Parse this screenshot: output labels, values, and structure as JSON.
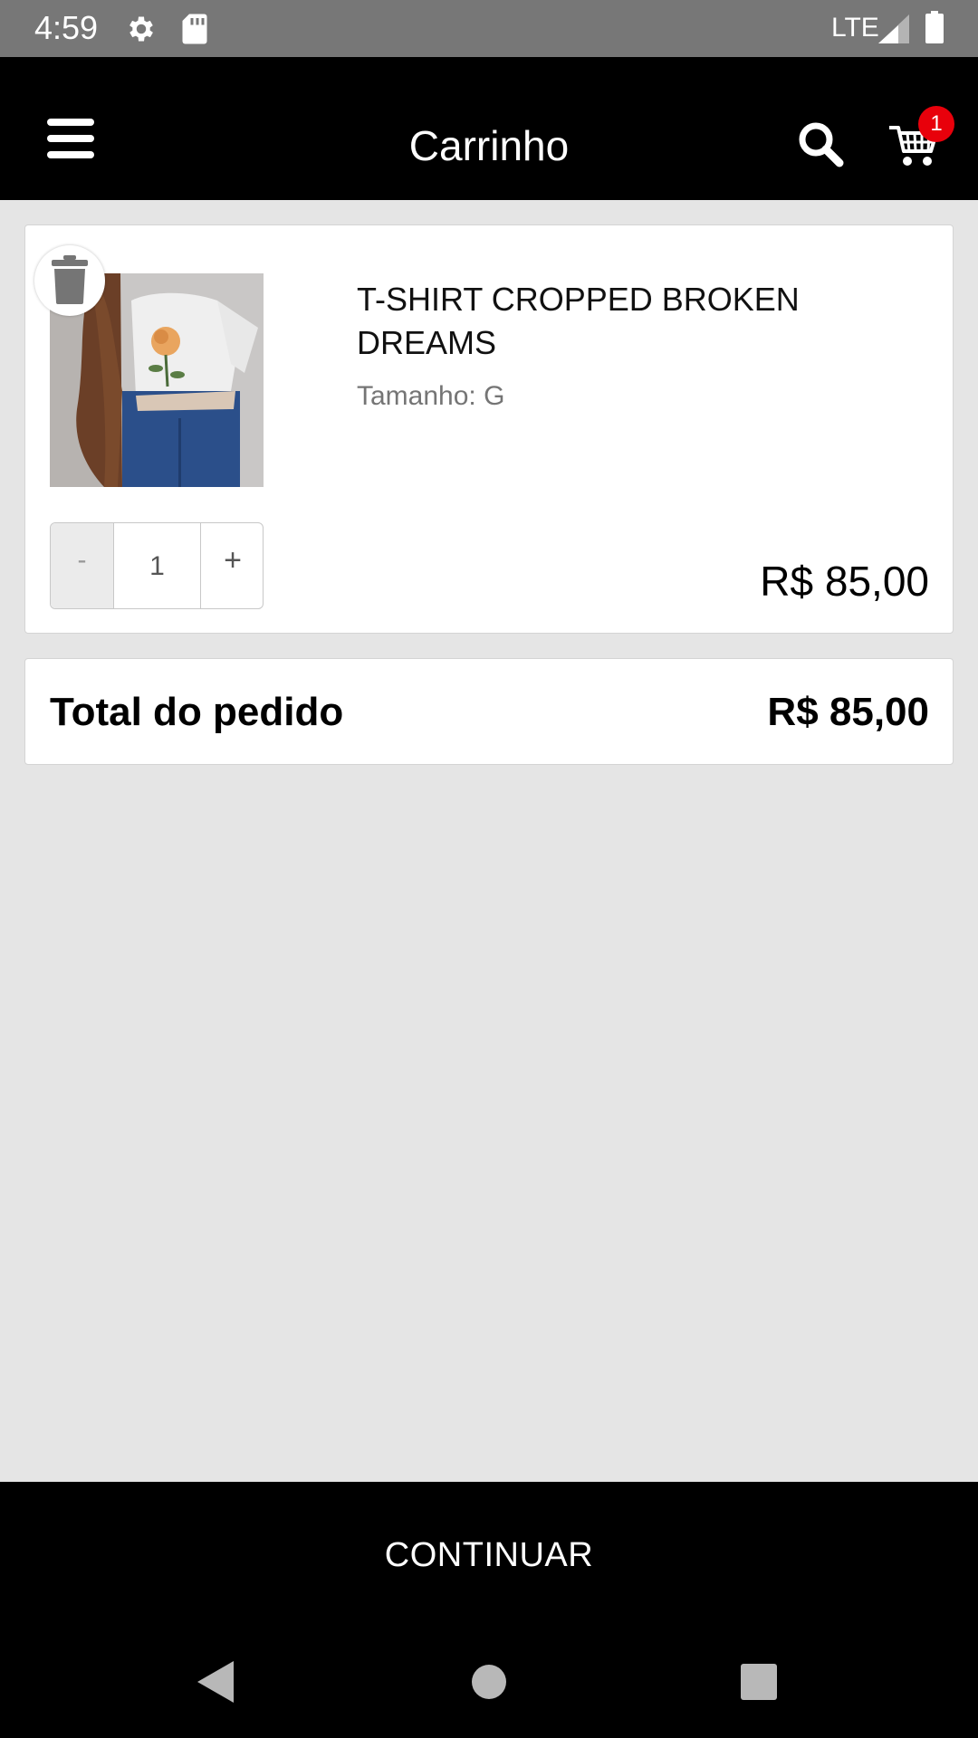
{
  "status_bar": {
    "time": "4:59",
    "network": "LTE",
    "icons": [
      "gear-icon",
      "sd-card-icon",
      "signal-icon",
      "battery-icon"
    ]
  },
  "app_bar": {
    "title": "Carrinho",
    "menu_icon": "hamburger-menu-icon",
    "search_icon": "search-icon",
    "cart_icon": "cart-icon",
    "cart_badge": "1",
    "background": "#000000",
    "badge_color": "#e8000b"
  },
  "cart": {
    "items": [
      {
        "name": "T-SHIRT CROPPED BROKEN DREAMS",
        "size": "Tamanho: G",
        "quantity": "1",
        "decrement_label": "-",
        "increment_label": "+",
        "price": "R$ 85,00",
        "image": "product-photo-tshirt-rose",
        "delete_icon": "trash-icon"
      }
    ]
  },
  "summary": {
    "total_label": "Total do pedido",
    "total_value": "R$ 85,00"
  },
  "footer": {
    "continue_label": "CONTINUAR"
  },
  "nav_bar": {
    "icons": [
      "back-icon",
      "home-icon",
      "recents-icon"
    ]
  }
}
